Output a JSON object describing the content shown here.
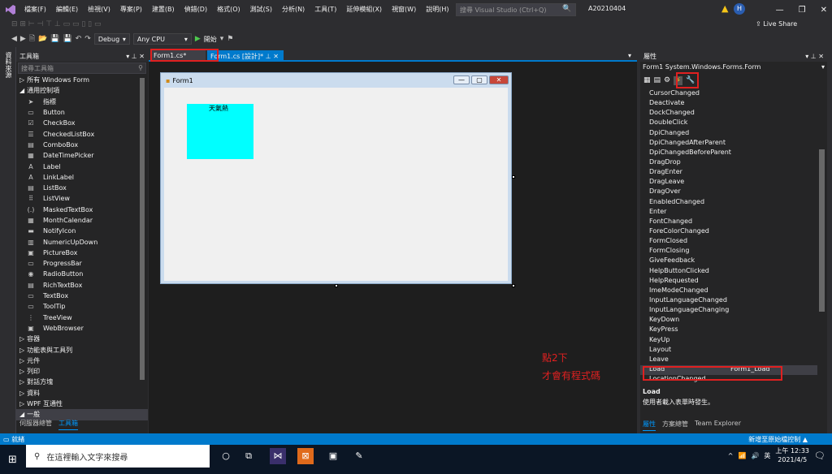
{
  "menu": [
    "檔案(F)",
    "編輯(E)",
    "檢視(V)",
    "專案(P)",
    "建置(B)",
    "偵錯(D)",
    "格式(O)",
    "測試(S)",
    "分析(N)",
    "工具(T)",
    "延伸模組(X)",
    "視窗(W)",
    "說明(H)"
  ],
  "search": {
    "placeholder": "搜尋 Visual Studio (Ctrl+Q)"
  },
  "solution_name": "A20210404",
  "account_initial": "H",
  "live_share": "Live Share",
  "toolbar": {
    "config": "Debug",
    "platform": "Any CPU",
    "start": "開始"
  },
  "side_strip_label": "資料來源",
  "toolbox": {
    "title": "工具箱",
    "search_placeholder": "搜尋工具箱",
    "all_forms": "所有 Windows Form",
    "common_controls": "通用控制項",
    "items": [
      {
        "icon": "➤",
        "label": "指標"
      },
      {
        "icon": "▭",
        "label": "Button"
      },
      {
        "icon": "☑",
        "label": "CheckBox"
      },
      {
        "icon": "☰",
        "label": "CheckedListBox"
      },
      {
        "icon": "▤",
        "label": "ComboBox"
      },
      {
        "icon": "▦",
        "label": "DateTimePicker"
      },
      {
        "icon": "A",
        "label": "Label"
      },
      {
        "icon": "A",
        "label": "LinkLabel"
      },
      {
        "icon": "▤",
        "label": "ListBox"
      },
      {
        "icon": "⠿",
        "label": "ListView"
      },
      {
        "icon": "(.)",
        "label": "MaskedTextBox"
      },
      {
        "icon": "▦",
        "label": "MonthCalendar"
      },
      {
        "icon": "▬",
        "label": "NotifyIcon"
      },
      {
        "icon": "▥",
        "label": "NumericUpDown"
      },
      {
        "icon": "▣",
        "label": "PictureBox"
      },
      {
        "icon": "▭",
        "label": "ProgressBar"
      },
      {
        "icon": "◉",
        "label": "RadioButton"
      },
      {
        "icon": "▤",
        "label": "RichTextBox"
      },
      {
        "icon": "▭",
        "label": "TextBox"
      },
      {
        "icon": "▭",
        "label": "ToolTip"
      },
      {
        "icon": "⋮",
        "label": "TreeView"
      },
      {
        "icon": "▣",
        "label": "WebBrowser"
      }
    ],
    "categories": [
      "容器",
      "功能表與工具列",
      "元件",
      "列印",
      "對話方塊",
      "資料",
      "WPF 互通性",
      "一般"
    ],
    "bottom_tabs": [
      "伺服器總管",
      "工具箱"
    ]
  },
  "doc_tabs": {
    "tab1": "Form1.cs*",
    "tab2": "Form1.cs [設計]*"
  },
  "form": {
    "title": "Form1",
    "label": "天氣熱"
  },
  "annotation": {
    "line1": "點2下",
    "line2": "才會有程式碼"
  },
  "properties": {
    "title": "屬性",
    "object": "Form1  System.Windows.Forms.Form",
    "events": [
      {
        "name": "CursorChanged",
        "value": ""
      },
      {
        "name": "Deactivate",
        "value": ""
      },
      {
        "name": "DockChanged",
        "value": ""
      },
      {
        "name": "DoubleClick",
        "value": ""
      },
      {
        "name": "DpiChanged",
        "value": ""
      },
      {
        "name": "DpiChangedAfterParent",
        "value": ""
      },
      {
        "name": "DpiChangedBeforeParent",
        "value": ""
      },
      {
        "name": "DragDrop",
        "value": ""
      },
      {
        "name": "DragEnter",
        "value": ""
      },
      {
        "name": "DragLeave",
        "value": ""
      },
      {
        "name": "DragOver",
        "value": ""
      },
      {
        "name": "EnabledChanged",
        "value": ""
      },
      {
        "name": "Enter",
        "value": ""
      },
      {
        "name": "FontChanged",
        "value": ""
      },
      {
        "name": "ForeColorChanged",
        "value": ""
      },
      {
        "name": "FormClosed",
        "value": ""
      },
      {
        "name": "FormClosing",
        "value": ""
      },
      {
        "name": "GiveFeedback",
        "value": ""
      },
      {
        "name": "HelpButtonClicked",
        "value": ""
      },
      {
        "name": "HelpRequested",
        "value": ""
      },
      {
        "name": "ImeModeChanged",
        "value": ""
      },
      {
        "name": "InputLanguageChanged",
        "value": ""
      },
      {
        "name": "InputLanguageChanging",
        "value": ""
      },
      {
        "name": "KeyDown",
        "value": ""
      },
      {
        "name": "KeyPress",
        "value": ""
      },
      {
        "name": "KeyUp",
        "value": ""
      },
      {
        "name": "Layout",
        "value": ""
      },
      {
        "name": "Leave",
        "value": ""
      },
      {
        "name": "Load",
        "value": "Form1_Load"
      },
      {
        "name": "LocationChanged",
        "value": ""
      }
    ],
    "desc_title": "Load",
    "desc_text": "使用者載入表單時發生。",
    "bottom_tabs": [
      "屬性",
      "方案總管",
      "Team Explorer"
    ]
  },
  "status": {
    "text": "就緒",
    "right": "新增至原始檔控制 ▲"
  },
  "taskbar": {
    "search_placeholder": "在這裡輸入文字來搜尋",
    "ime": "英",
    "time": "上午 12:33",
    "date": "2021/4/5"
  },
  "colors": {
    "accent": "#007acc",
    "annotation": "#e02020",
    "panel": "#00ffff"
  }
}
